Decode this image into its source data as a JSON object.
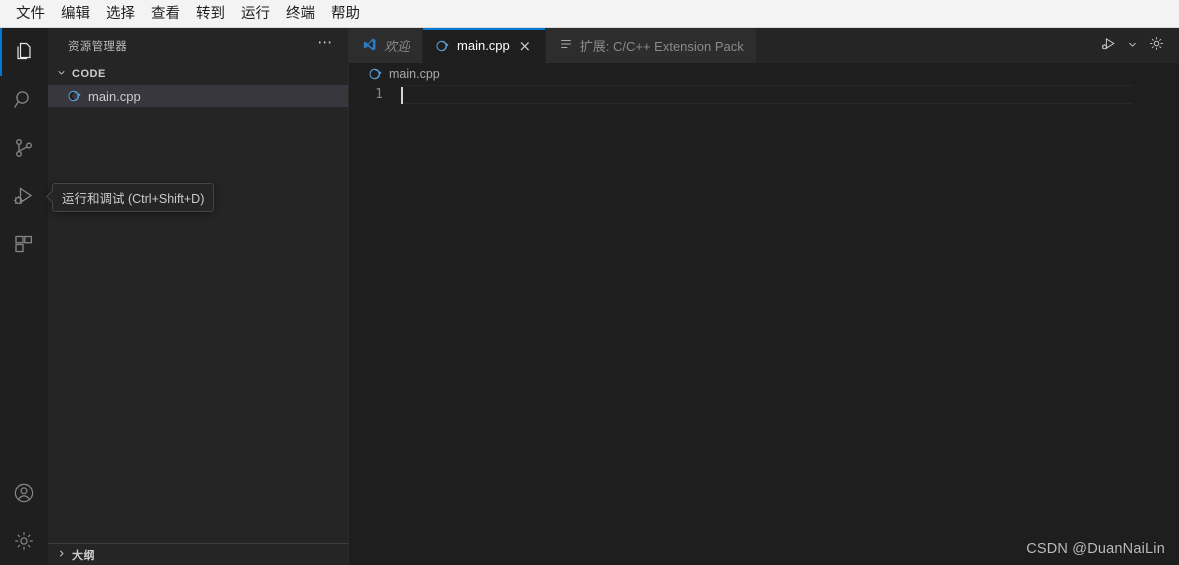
{
  "menubar": {
    "items": [
      {
        "label": "文件",
        "name": "menu-file"
      },
      {
        "label": "编辑",
        "name": "menu-edit"
      },
      {
        "label": "选择",
        "name": "menu-selection"
      },
      {
        "label": "查看",
        "name": "menu-view"
      },
      {
        "label": "转到",
        "name": "menu-go"
      },
      {
        "label": "运行",
        "name": "menu-run"
      },
      {
        "label": "终端",
        "name": "menu-terminal"
      },
      {
        "label": "帮助",
        "name": "menu-help"
      }
    ]
  },
  "activity_bar": {
    "items": [
      {
        "icon": "files-explorer-icon",
        "active": true
      },
      {
        "icon": "search-icon",
        "active": false
      },
      {
        "icon": "source-control-icon",
        "active": false
      },
      {
        "icon": "run-and-debug-icon",
        "active": false
      },
      {
        "icon": "extensions-icon",
        "active": false
      }
    ],
    "bottom_items": [
      {
        "icon": "account-icon"
      },
      {
        "icon": "manage-gear-icon"
      }
    ]
  },
  "tooltip": {
    "text": "运行和调试 (Ctrl+Shift+D)"
  },
  "sidebar": {
    "title": "资源管理器",
    "more_actions_label": "⋯",
    "folder": {
      "label": "CODE",
      "expanded": true,
      "children": [
        {
          "label": "main.cpp",
          "icon": "cpp-file-icon",
          "selected": true
        }
      ]
    },
    "outline": {
      "label": "大纲",
      "expanded": false
    }
  },
  "editor": {
    "tabs": [
      {
        "label": "欢迎",
        "icon": "vscode-logo-icon",
        "active": false,
        "preview": true,
        "closable": false
      },
      {
        "label": "main.cpp",
        "icon": "cpp-file-icon",
        "active": true,
        "preview": false,
        "closable": true,
        "close_label": "×"
      },
      {
        "label": "扩展: C/C++ Extension Pack",
        "icon": "extension-list-icon",
        "active": false,
        "preview": false,
        "closable": false
      }
    ],
    "toolbar": [
      {
        "icon": "run-or-debug-icon"
      },
      {
        "icon": "chevron-down-icon"
      },
      {
        "icon": "settings-gear-icon"
      }
    ],
    "breadcrumb": {
      "label": "main.cpp",
      "icon": "cpp-file-icon"
    },
    "lines": [
      {
        "number": "1",
        "text": "",
        "cursor": true
      }
    ]
  },
  "watermark": {
    "text": "CSDN @DuanNaiLin"
  },
  "colors": {
    "accent_blue": "#0078d4",
    "menubar_bg": "#f3f3f3",
    "activitybar_bg": "#1f1f1f",
    "sidebar_bg": "#252526",
    "editor_bg": "#1e1e1e",
    "tab_inactive_bg": "#2d2d2d",
    "selection_bg": "#37373d",
    "cpp_icon_blue": "#5a9fd4"
  }
}
